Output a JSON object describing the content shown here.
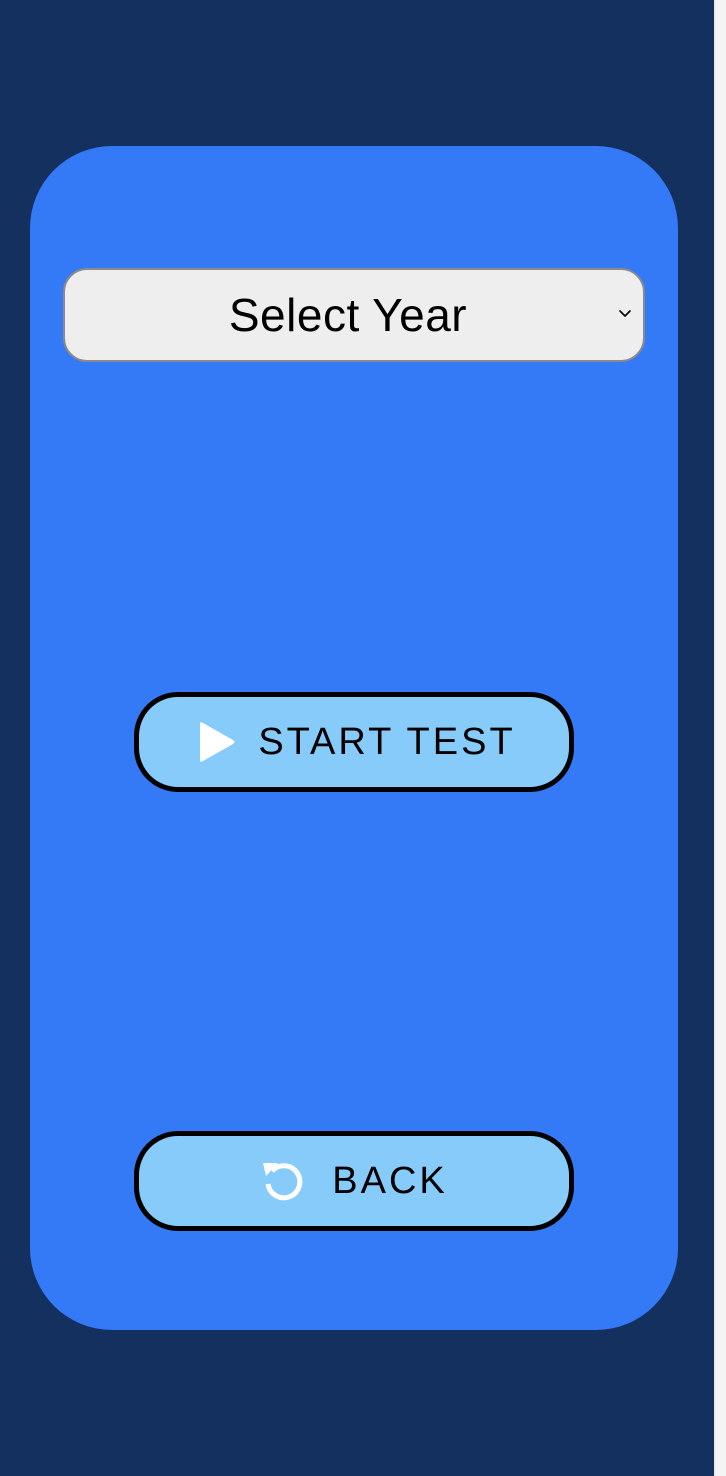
{
  "year_select": {
    "label": "Select Year",
    "icon": "chevron-down-icon"
  },
  "start_test": {
    "label": "START TEST",
    "icon": "play-icon"
  },
  "back": {
    "label": "BACK",
    "icon": "undo-icon"
  },
  "colors": {
    "background": "#14305f",
    "card": "#3479f5",
    "button": "#86cbfa",
    "select": "#eeeeee"
  }
}
